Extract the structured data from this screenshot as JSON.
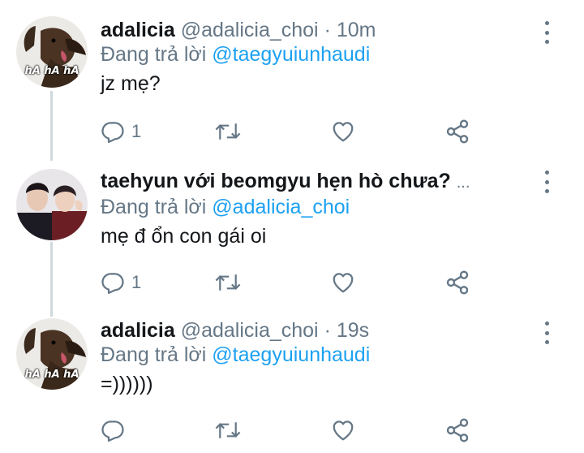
{
  "tweets": [
    {
      "name": "adalicia",
      "handle": "@adalicia_choi",
      "separator": "·",
      "time": "10m",
      "reply_prefix": "Đang trả lời",
      "reply_to": "@taegyuiunhaudi",
      "text": "jz mẹ?",
      "avatar_caption": "hA hA hA",
      "reply_count": "1"
    },
    {
      "name": "taehyun với beomgyu hẹn hò chưa?",
      "ellipsis": "...",
      "reply_prefix": "Đang trả lời",
      "reply_to": "@adalicia_choi",
      "text": "mẹ đ ổn con gái oi",
      "reply_count": "1"
    },
    {
      "name": "adalicia",
      "handle": "@adalicia_choi",
      "separator": "·",
      "time": "19s",
      "reply_prefix": "Đang trả lời",
      "reply_to": "@taegyuiunhaudi",
      "text": "=))))))",
      "avatar_caption": "hA hA hA",
      "reply_count": ""
    }
  ],
  "colors": {
    "text": "#14171a",
    "secondary": "#657786",
    "mention": "#1da1f2",
    "thread_line": "#cfd9de"
  },
  "icons": [
    "reply-icon",
    "retweet-icon",
    "like-icon",
    "share-icon",
    "more-icon"
  ]
}
